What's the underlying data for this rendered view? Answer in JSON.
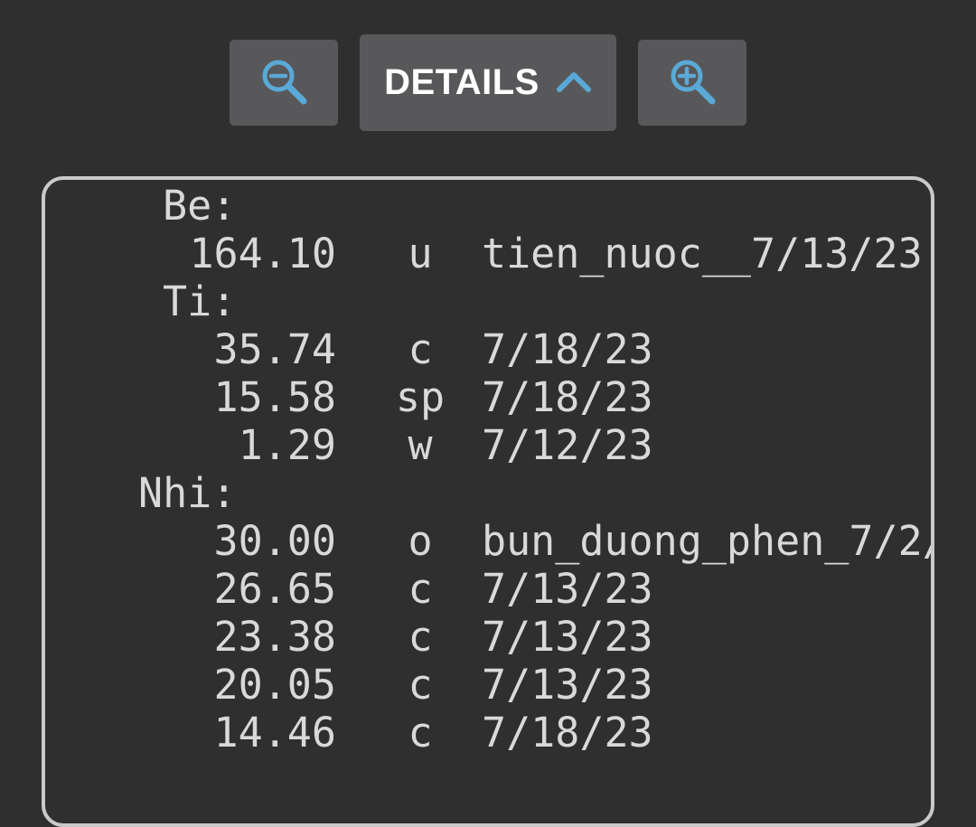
{
  "toolbar": {
    "zoom_out_icon": "zoom-out-icon",
    "details_label": "DETAILS",
    "details_chevron_icon": "chevron-up-icon",
    "zoom_in_icon": "zoom-in-icon",
    "accent_color": "#5aa9d6"
  },
  "ledger": {
    "groups": [
      {
        "label": "Be:",
        "entries": [
          {
            "amount": "164.10",
            "code": "u",
            "note": "tien_nuoc__7/13/23"
          }
        ]
      },
      {
        "label": "Ti:",
        "entries": [
          {
            "amount": "35.74",
            "code": "c",
            "note": "7/18/23"
          },
          {
            "amount": "15.58",
            "code": "sp",
            "note": "7/18/23"
          },
          {
            "amount": "1.29",
            "code": "w",
            "note": "7/12/23"
          }
        ]
      },
      {
        "label": "Nhi:",
        "entries": [
          {
            "amount": "30.00",
            "code": "o",
            "note": "bun_duong_phen_7/2/"
          },
          {
            "amount": "26.65",
            "code": "c",
            "note": "7/13/23"
          },
          {
            "amount": "23.38",
            "code": "c",
            "note": "7/13/23"
          },
          {
            "amount": "20.05",
            "code": "c",
            "note": "7/13/23"
          },
          {
            "amount": "14.46",
            "code": "c",
            "note": "7/18/23"
          }
        ]
      }
    ]
  }
}
